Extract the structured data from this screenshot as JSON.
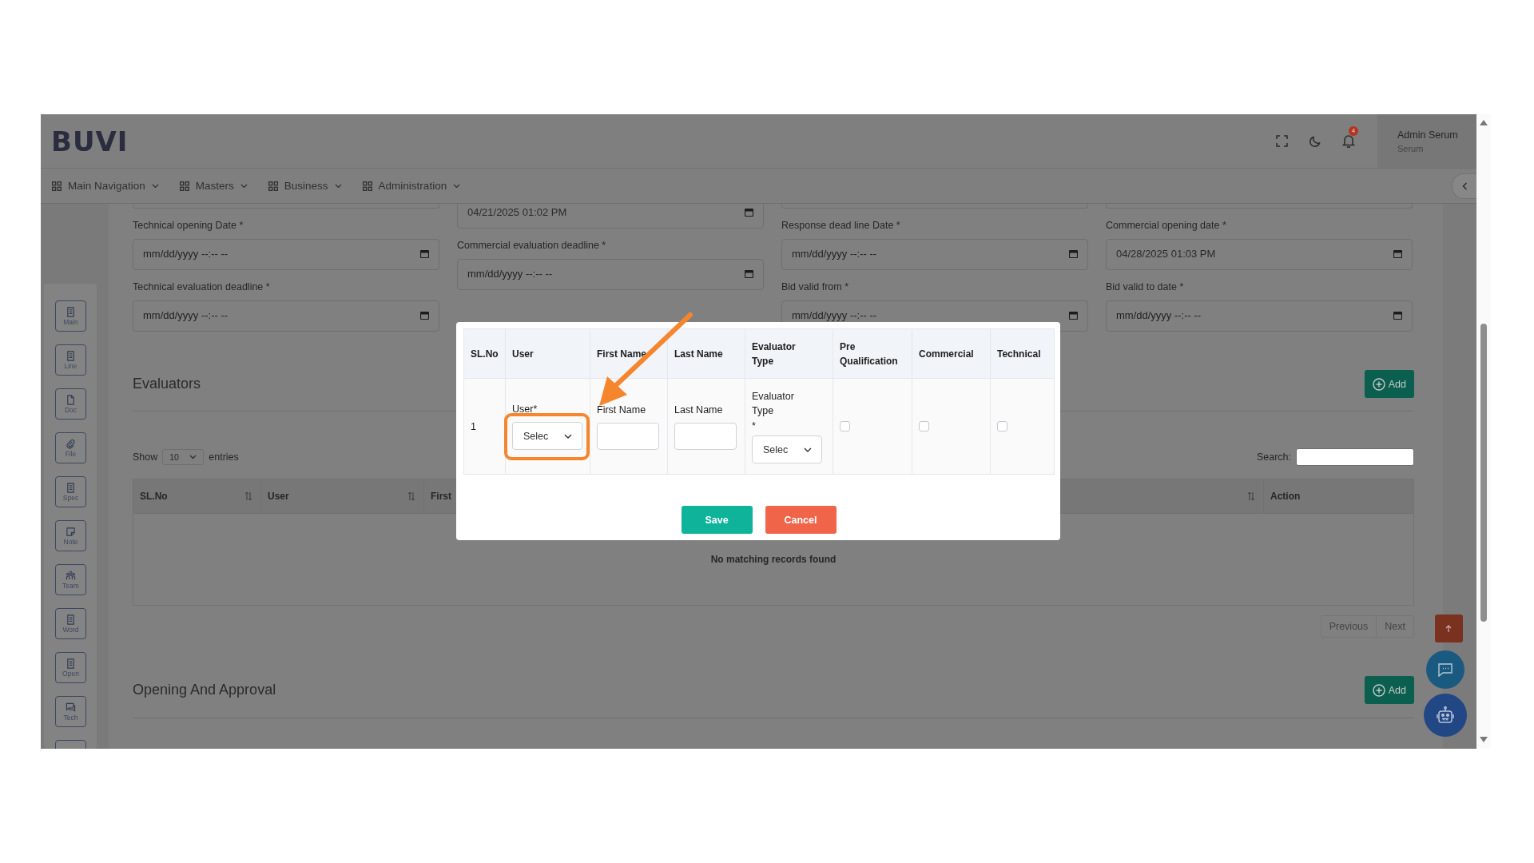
{
  "header": {
    "logo": "BUVI",
    "notification_count": "4",
    "user_name": "Admin Serum",
    "user_role": "Serum"
  },
  "nav": [
    {
      "label": "Main Navigation"
    },
    {
      "label": "Masters"
    },
    {
      "label": "Business"
    },
    {
      "label": "Administration"
    }
  ],
  "sidebar": [
    {
      "label": "Main",
      "kind": "list"
    },
    {
      "label": "Line",
      "kind": "list"
    },
    {
      "label": "Doc",
      "kind": "page"
    },
    {
      "label": "File",
      "kind": "clip"
    },
    {
      "label": "Spec",
      "kind": "list"
    },
    {
      "label": "Note",
      "kind": "note"
    },
    {
      "label": "Team",
      "kind": "team"
    },
    {
      "label": "Word",
      "kind": "list"
    },
    {
      "label": "Open",
      "kind": "list"
    },
    {
      "label": "Tech",
      "kind": "chat"
    },
    {
      "kind": "chat"
    }
  ],
  "form": {
    "columns": [
      {
        "fields": [
          {
            "kind": "cut"
          },
          {
            "kind": "date",
            "label": "Technical opening Date *",
            "placeholder": "mm/dd/yyyy --:-- --"
          },
          {
            "kind": "date",
            "label": "Technical evaluation deadline *",
            "placeholder": "mm/dd/yyyy --:-- --"
          }
        ]
      },
      {
        "fields": [
          {
            "kind": "date",
            "value": "04/21/2025 01:02 PM"
          },
          {
            "kind": "date",
            "label": "Commercial evaluation deadline *",
            "placeholder": "mm/dd/yyyy --:-- --"
          }
        ]
      },
      {
        "fields": [
          {
            "kind": "cut"
          },
          {
            "kind": "date",
            "label": "Response dead line Date *",
            "placeholder": "mm/dd/yyyy --:-- --"
          },
          {
            "kind": "date",
            "label": "Bid valid from *",
            "placeholder": "mm/dd/yyyy --:-- --"
          }
        ]
      },
      {
        "fields": [
          {
            "kind": "cut"
          },
          {
            "kind": "date",
            "label": "Commercial opening date *",
            "value": "04/28/2025 01:03 PM"
          },
          {
            "kind": "date",
            "label": "Bid valid to date *",
            "placeholder": "mm/dd/yyyy --:-- --"
          }
        ]
      }
    ]
  },
  "evaluators": {
    "title": "Evaluators",
    "add_label": "Add",
    "show_label": "Show",
    "page_size": "10",
    "entries_label": "entries",
    "search_label": "Search:",
    "columns": [
      {
        "label": "SL.No",
        "sortable": true
      },
      {
        "label": "User",
        "sortable": true
      },
      {
        "label": "First",
        "sortable": false
      },
      {
        "sortable": true
      },
      {
        "label": "Action",
        "sortable": false
      }
    ],
    "empty_message": "No matching records found",
    "pagination": [
      "Previous",
      "Next"
    ]
  },
  "opening_approval": {
    "title": "Opening And Approval",
    "add_label": "Add"
  },
  "modal": {
    "columns": [
      "SL.No",
      "User",
      "First Name",
      "Last Name",
      "Evaluator Type",
      "Pre Qualification",
      "Commercial",
      "Technical"
    ],
    "row": {
      "sl_no": "1",
      "user_label": "User*",
      "user_select": "Selec",
      "first_name_label": "First Name",
      "last_name_label": "Last Name",
      "evaluator_type_label": "Evaluator Type",
      "evaluator_type_required": "*",
      "evaluator_type_select": "Selec",
      "pre_qualification_checked": false,
      "commercial_checked": false,
      "technical_checked": false
    },
    "buttons": [
      {
        "label": "Save",
        "kind": "primary"
      },
      {
        "label": "Cancel",
        "kind": "danger"
      }
    ]
  }
}
